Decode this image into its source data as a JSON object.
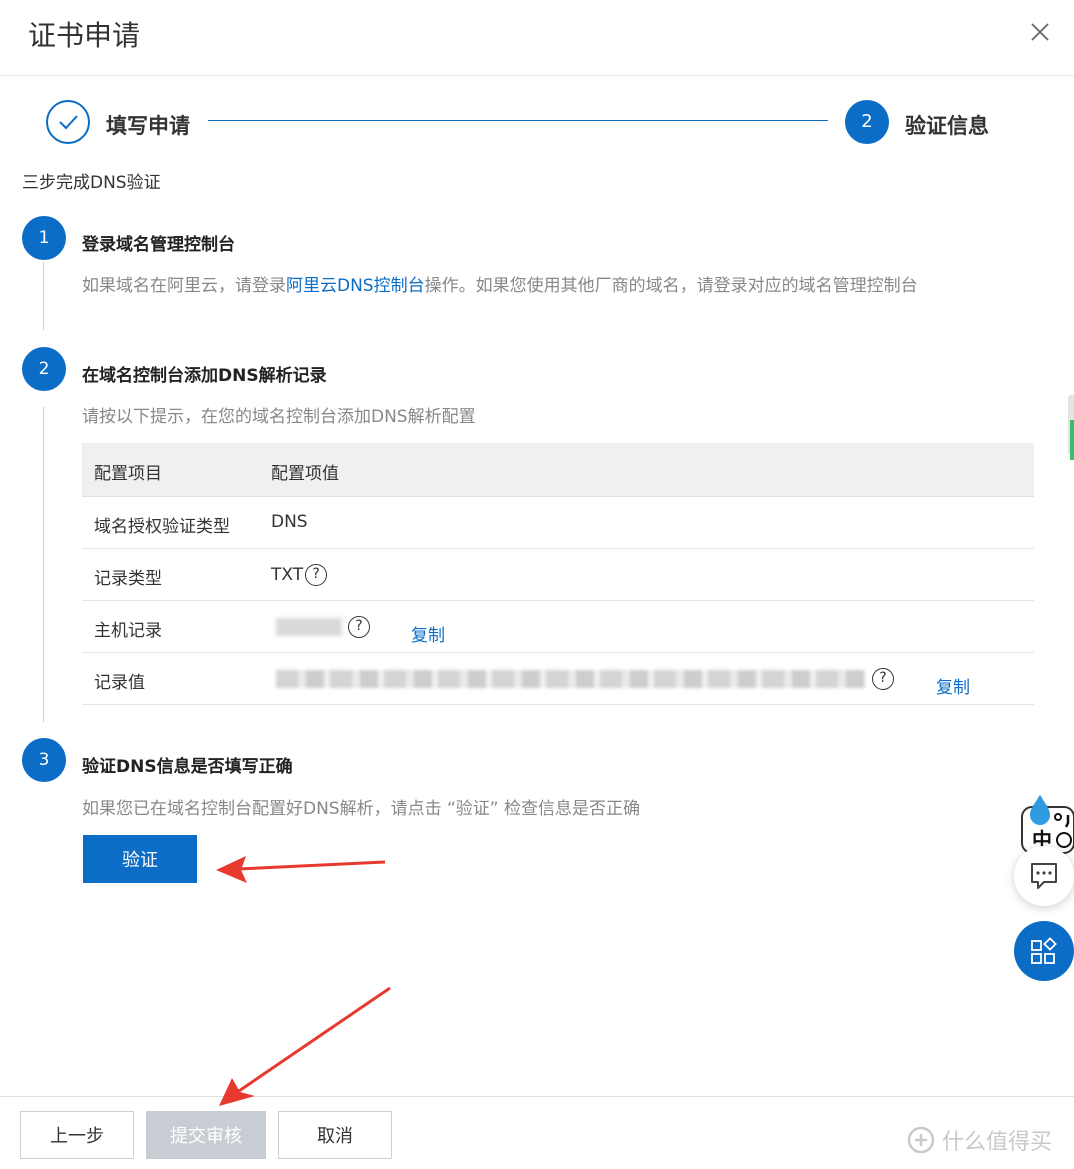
{
  "dialog": {
    "title": "证书申请"
  },
  "stepper": {
    "step1_label": "填写申请",
    "step2_number": "2",
    "step2_label": "验证信息"
  },
  "intro": "三步完成DNS验证",
  "sections": [
    {
      "number": "1",
      "title": "登录域名管理控制台",
      "desc_before": "如果域名在阿里云，请登录",
      "desc_link": "阿里云DNS控制台",
      "desc_after": "操作。如果您使用其他厂商的域名，请登录对应的域名管理控制台"
    },
    {
      "number": "2",
      "title": "在域名控制台添加DNS解析记录",
      "desc": "请按以下提示，在您的域名控制台添加DNS解析配置"
    },
    {
      "number": "3",
      "title": "验证DNS信息是否填写正确",
      "desc": "如果您已在域名控制台配置好DNS解析，请点击 “验证” 检查信息是否正确"
    }
  ],
  "table": {
    "headers": [
      "配置项目",
      "配置项值"
    ],
    "rows": [
      {
        "name": "域名授权验证类型",
        "value": "DNS"
      },
      {
        "name": "记录类型",
        "value": "TXT"
      },
      {
        "name": "主机记录",
        "value": "",
        "copy": "复制"
      },
      {
        "name": "记录值",
        "value": "",
        "copy": "复制"
      }
    ]
  },
  "qmark_glyph": "?",
  "verify_button": "验证",
  "footer": {
    "prev": "上一步",
    "submit": "提交审核",
    "cancel": "取消"
  },
  "watermark": "什么值得买",
  "colors": {
    "primary": "#0b6dc6",
    "disabled": "#c8cdd3",
    "annotation_arrow": "#e8392f"
  },
  "icons": [
    "close-icon",
    "check-icon",
    "question-icon",
    "chat-icon",
    "apps-icon",
    "ime-icon"
  ]
}
